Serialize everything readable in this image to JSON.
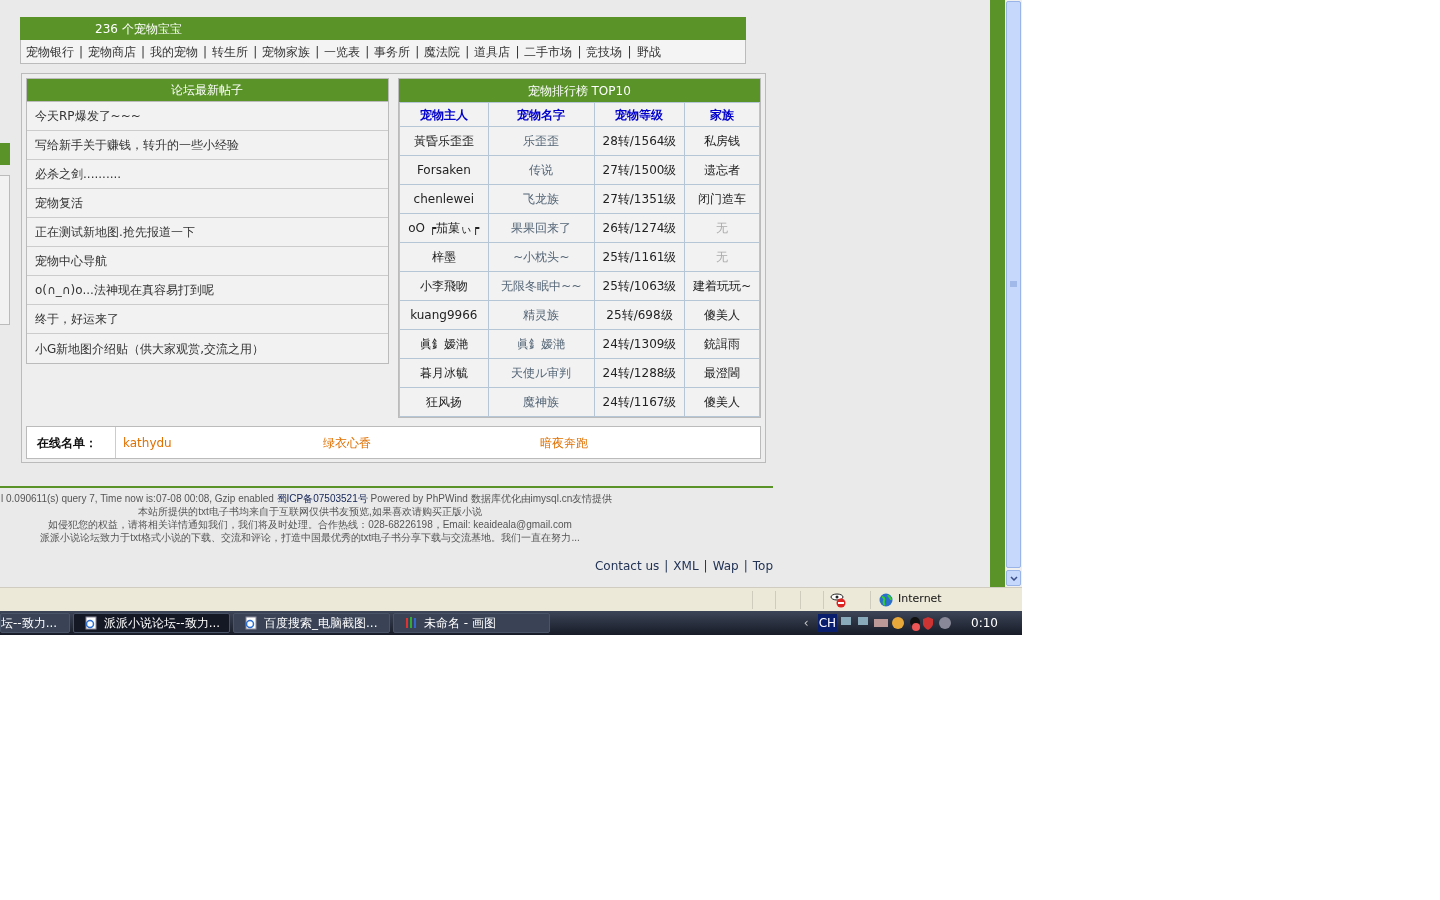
{
  "header": {
    "title": "236 个宠物宝宝"
  },
  "nav_separator": "|",
  "nav": [
    "宠物银行",
    "宠物商店",
    "我的宠物",
    "转生所",
    "宠物家族",
    "一览表",
    "事务所",
    "魔法院",
    "道具店",
    "二手市场",
    "竞技场",
    "野战"
  ],
  "forum": {
    "title": "论坛最新帖子",
    "posts": [
      "今天RP爆发了~~~",
      "写给新手关于赚钱，转升的一些小经验",
      "必杀之剑..........",
      "宠物复活",
      "正在测试新地图.抢先报道一下",
      "宠物中心导航",
      "o(∩_∩)o...法神现在真容易打到呢",
      "终于，好运来了",
      "小G新地图介绍贴（供大家观赏,交流之用）"
    ]
  },
  "ranking": {
    "title": "宠物排行榜 TOP10",
    "columns": [
      "宠物主人",
      "宠物名字",
      "宠物等级",
      "家族"
    ],
    "rows": [
      {
        "owner": "黃昏乐歪歪",
        "pet": "乐歪歪",
        "level": "28转/1564级",
        "family": "私房钱",
        "muted": false
      },
      {
        "owner": "Forsaken",
        "pet": "传说",
        "level": "27转/1500级",
        "family": "遗忘者",
        "muted": false
      },
      {
        "owner": "chenlewei",
        "pet": "飞龙族",
        "level": "27转/1351级",
        "family": "闭门造车",
        "muted": false
      },
      {
        "owner": "oO ┍茄菓ぃ┍",
        "pet": "果果回来了",
        "level": "26转/1274级",
        "family": "无",
        "muted": true
      },
      {
        "owner": "梓墨",
        "pet": "~小枕头~",
        "level": "25转/1161级",
        "family": "无",
        "muted": true
      },
      {
        "owner": "小李飛吻",
        "pet": "无限冬眠中~~",
        "level": "25转/1063级",
        "family": "建着玩玩~",
        "muted": false
      },
      {
        "owner": "kuang9966",
        "pet": "精灵族",
        "level": "25转/698级",
        "family": "傻美人",
        "muted": false
      },
      {
        "owner": "眞釒嫒滟",
        "pet": "眞釒嫒滟",
        "level": "24转/1309级",
        "family": "銃諿雨",
        "muted": false
      },
      {
        "owner": "暮月冰毓",
        "pet": "天使ル审判",
        "level": "24转/1288级",
        "family": "最澄閪",
        "muted": false
      },
      {
        "owner": "狂风扬",
        "pet": "魔神族",
        "level": "24转/1167级",
        "family": "傻美人",
        "muted": false
      }
    ]
  },
  "online": {
    "label": "在线名单：",
    "users": [
      "kathydu",
      "绿衣心香",
      "暗夜奔跑"
    ]
  },
  "footer": {
    "line1_before": "l 0.090611(s) query 7, Time now is:07-08 00:08, Gzip enabled",
    "icp": "蜀ICP备07503521号",
    "line1_after": "Powered by PhPWind 数据库优化由imysql.cn友情提供",
    "lines": [
      "本站所提供的txt电子书均来自于互联网仅供书友预览,如果喜欢请购买正版小说",
      "如侵犯您的权益，请将相关详情通知我们，我们将及时处理。合作热线：028-68226198，Email: keaideala@gmail.com",
      "派派小说论坛致力于txt格式小说的下载、交流和评论，打造中国最优秀的txt电子书分享下载与交流基地。我们一直在努力..."
    ],
    "link_separator": "|",
    "links": [
      "Contact us",
      "XML",
      "Wap",
      "Top"
    ]
  },
  "status_bar": {
    "zone": "Internet"
  },
  "taskbar": {
    "tasks": [
      {
        "label": "坛--致力...",
        "selected": false
      },
      {
        "label": "派派小说论坛--致力...",
        "selected": true
      },
      {
        "label": "百度搜索_电脑截图...",
        "selected": false
      },
      {
        "label": "未命名 - 画图",
        "selected": false
      }
    ],
    "tray_arrow": "‹",
    "language": "CH",
    "clock": "0:10"
  }
}
